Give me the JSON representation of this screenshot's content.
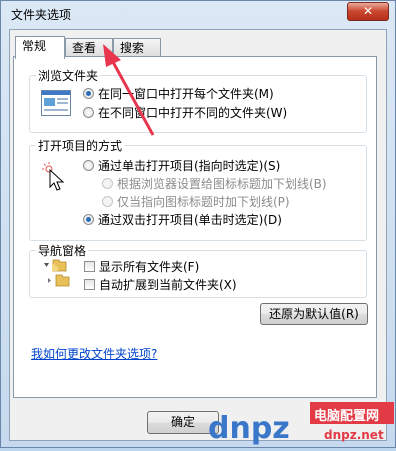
{
  "window": {
    "title": "文件夹选项",
    "close_label": "✕"
  },
  "tabs": [
    {
      "label": "常规",
      "active": true
    },
    {
      "label": "查看",
      "active": false
    },
    {
      "label": "搜索",
      "active": false
    }
  ],
  "browse": {
    "label": "浏览文件夹",
    "options": [
      {
        "label": "在同一窗口中打开每个文件夹(M)",
        "checked": true
      },
      {
        "label": "在不同窗口中打开不同的文件夹(W)",
        "checked": false
      }
    ]
  },
  "open": {
    "label": "打开项目的方式",
    "single": {
      "label": "通过单击打开项目(指向时选定)(S)",
      "checked": false
    },
    "sub1": {
      "label": "根据浏览器设置给图标标题加下划线(B)"
    },
    "sub2": {
      "label": "仅当指向图标标题时加下划线(P)"
    },
    "double": {
      "label": "通过双击打开项目(单击时选定)(D)",
      "checked": true
    }
  },
  "nav": {
    "label": "导航窗格",
    "show_all": "显示所有文件夹(F)",
    "auto_expand": "自动扩展到当前文件夹(X)"
  },
  "restore_label": "还原为默认值(R)",
  "help_link": "我如何更改文件夹选项?",
  "ok_label": "确定",
  "watermark": {
    "brand": "dnpz.net",
    "site": "电脑配置网",
    "domain": "dnpz.net"
  },
  "colors": {
    "accent": "#2d6db6",
    "link": "#0044cc",
    "annotation_arrow": "#e8364f"
  }
}
